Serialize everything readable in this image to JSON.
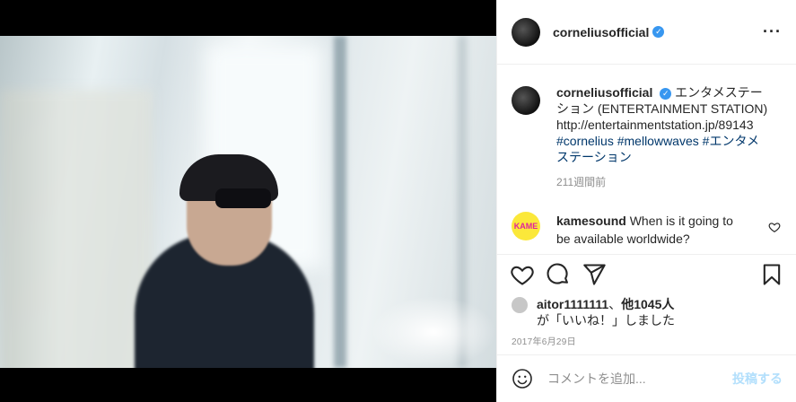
{
  "post": {
    "username": "corneliusofficial",
    "verified_icon": "verified-badge-icon",
    "caption_username": "corneliusofficial",
    "caption_text": "エンタメステーション (ENTERTAINMENT STATION)",
    "caption_link": "http://entertainmentstation.jp/89143",
    "hashtags": [
      "#cornelius",
      "#mellowwaves",
      "#エンタメステーション"
    ],
    "caption_time": "211週間前",
    "comment": {
      "username": "kamesound",
      "text": "When is it going to be available worldwide?",
      "avatar_label": "KAME"
    },
    "likes": {
      "first_user": "aitor1111111",
      "separator": "、",
      "others": "他1045人",
      "suffix": "が「いいね！」しました"
    },
    "date": "2017年6月29日",
    "comment_input": {
      "placeholder": "コメントを追加...",
      "post_label": "投稿する"
    }
  },
  "colors": {
    "link": "#00376b",
    "verified": "#3897f0",
    "post_button_disabled": "#b2dffc",
    "muted": "#8e8e8e"
  }
}
